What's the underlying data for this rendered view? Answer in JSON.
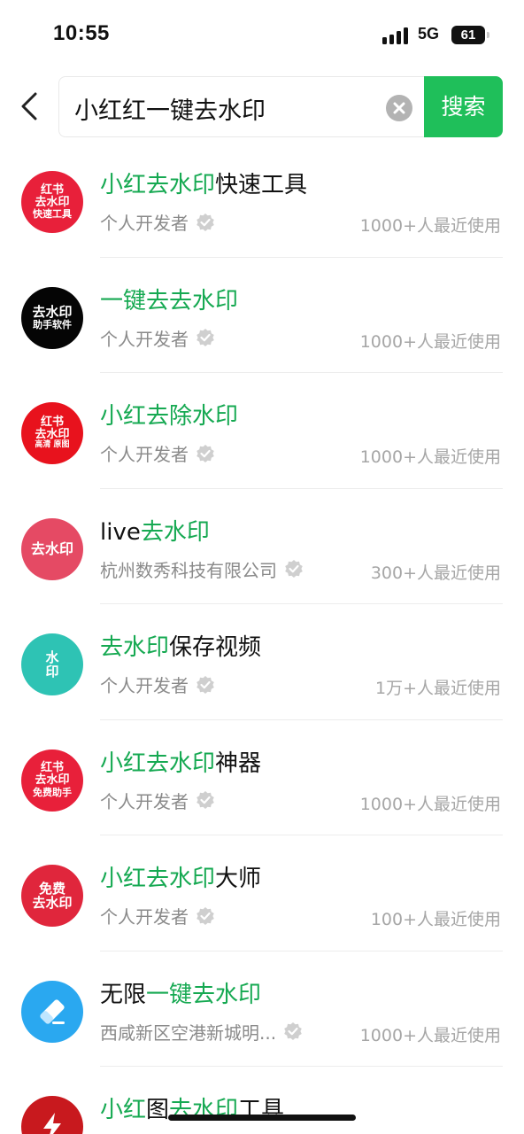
{
  "status": {
    "time": "10:55",
    "network": "5G",
    "battery": "61"
  },
  "search": {
    "query": "小红红一键去水印",
    "button_label": "搜索"
  },
  "results": [
    {
      "icon_lines": [
        "红书",
        "去水印",
        "快速工具"
      ],
      "icon_color": "#e8203a",
      "title": [
        {
          "t": "小红去水印",
          "hl": true
        },
        {
          "t": "快速工具",
          "hl": false
        }
      ],
      "developer": "个人开发者",
      "usage": "1000+人最近使用"
    },
    {
      "icon_lines": [
        "去水印",
        "助手软件"
      ],
      "icon_color": "#050505",
      "title": [
        {
          "t": "一键去去水印",
          "hl": true
        }
      ],
      "developer": "个人开发者",
      "usage": "1000+人最近使用"
    },
    {
      "icon_lines": [
        "红书",
        "去水印",
        "高清 原图"
      ],
      "icon_color": "#e8121d",
      "title": [
        {
          "t": "小红去除水印",
          "hl": true
        }
      ],
      "developer": "个人开发者",
      "usage": "1000+人最近使用"
    },
    {
      "icon_lines": [
        "去水印"
      ],
      "icon_color": "#e54a64",
      "title": [
        {
          "t": "live",
          "hl": false
        },
        {
          "t": "去水印",
          "hl": true
        }
      ],
      "developer": "杭州数秀科技有限公司",
      "usage": "300+人最近使用"
    },
    {
      "icon_lines": [
        "水",
        "印"
      ],
      "icon_color": "#2ec3b4",
      "title": [
        {
          "t": "去水印",
          "hl": true
        },
        {
          "t": "保存视频",
          "hl": false
        }
      ],
      "developer": "个人开发者",
      "usage": "1万+人最近使用"
    },
    {
      "icon_lines": [
        "红书",
        "去水印",
        "免费助手"
      ],
      "icon_color": "#e8203a",
      "title": [
        {
          "t": "小红去水印",
          "hl": true
        },
        {
          "t": "神器",
          "hl": false
        }
      ],
      "developer": "个人开发者",
      "usage": "1000+人最近使用"
    },
    {
      "icon_lines": [
        "免费",
        "去水印"
      ],
      "icon_color": "#e0263c",
      "title": [
        {
          "t": "小红去水印",
          "hl": true
        },
        {
          "t": "大师",
          "hl": false
        }
      ],
      "developer": "个人开发者",
      "usage": "100+人最近使用"
    },
    {
      "icon_lines": [],
      "icon_color": "#2aa8f0",
      "title": [
        {
          "t": "无限",
          "hl": false
        },
        {
          "t": "一键去水印",
          "hl": true
        }
      ],
      "developer": "西咸新区空港新城明...",
      "usage": "1000+人最近使用"
    },
    {
      "icon_lines": [],
      "icon_color": "#c8191e",
      "title": [
        {
          "t": "小红",
          "hl": true
        },
        {
          "t": "图",
          "hl": false
        },
        {
          "t": "去水印",
          "hl": true
        },
        {
          "t": "工具",
          "hl": false
        }
      ],
      "developer": "",
      "usage": ""
    }
  ],
  "colors": {
    "accent_green": "#1fbf5a",
    "highlight_green": "#16a952"
  },
  "icons": [
    "back-chevron-icon",
    "clear-icon",
    "verified-badge-icon",
    "eraser-icon",
    "signal-icon",
    "battery-icon"
  ]
}
